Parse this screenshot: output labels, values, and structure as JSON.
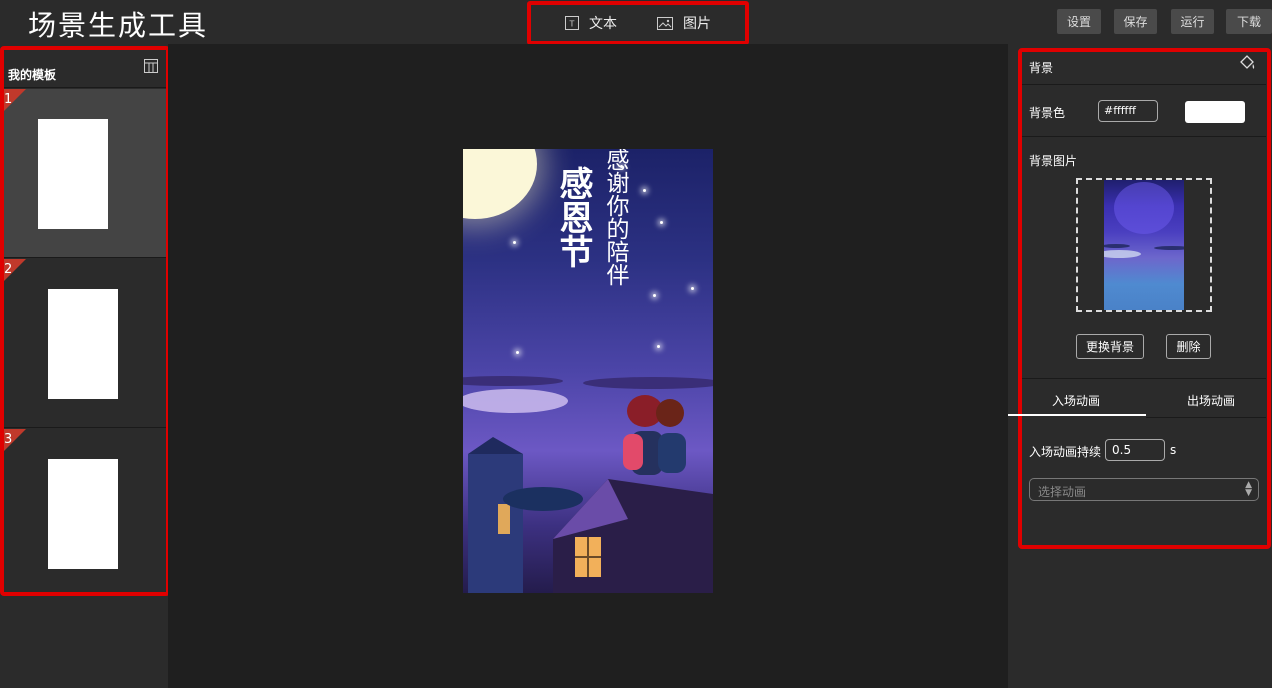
{
  "app": {
    "title": "场景生成工具"
  },
  "toolbar": {
    "text_label": "文本",
    "image_label": "图片",
    "settings_label": "设置",
    "save_label": "保存",
    "run_label": "运行",
    "download_label": "下载"
  },
  "templates": {
    "title": "我的模板",
    "items": [
      {
        "number": "1"
      },
      {
        "number": "2"
      },
      {
        "number": "3"
      }
    ]
  },
  "poster": {
    "title": "感恩节",
    "subtitle": "感谢你的陪伴"
  },
  "background_panel": {
    "title": "背景",
    "color_label": "背景色",
    "color_value": "#ffffff",
    "image_label": "背景图片",
    "change_button": "更换背景",
    "delete_button": "删除"
  },
  "animation": {
    "tabs": [
      "入场动画",
      "出场动画"
    ],
    "duration_label": "入场动画持续",
    "duration_value": "0.5",
    "duration_unit": "s",
    "select_placeholder": "选择动画"
  },
  "colors": {
    "highlight": "#e00000",
    "panel_bg": "#2b2b2b",
    "canvas_bg": "#1f1f1f",
    "template_corner": "#c0392b"
  }
}
